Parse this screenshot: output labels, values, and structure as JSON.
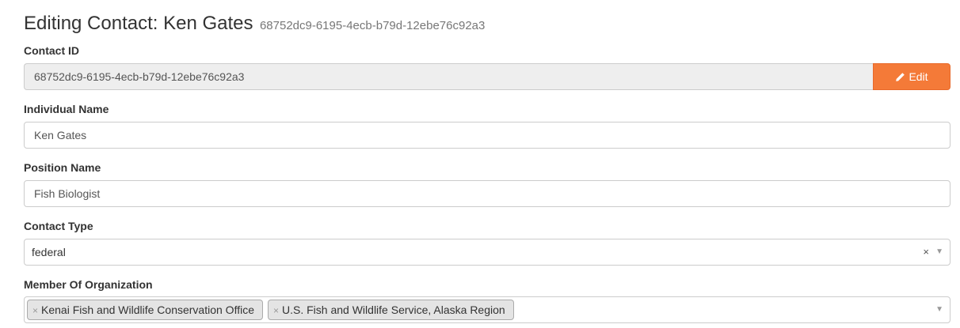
{
  "header": {
    "title": "Editing Contact: Ken Gates",
    "subtitle": "68752dc9-6195-4ecb-b79d-12ebe76c92a3"
  },
  "contact_id": {
    "label": "Contact ID",
    "value": "68752dc9-6195-4ecb-b79d-12ebe76c92a3",
    "edit_label": "Edit",
    "edit_icon": "pencil-icon",
    "edit_color": "#f47a38"
  },
  "individual_name": {
    "label": "Individual Name",
    "value": "Ken Gates"
  },
  "position_name": {
    "label": "Position Name",
    "value": "Fish Biologist"
  },
  "contact_type": {
    "label": "Contact Type",
    "selected": "federal",
    "clear_symbol": "×",
    "arrow_symbol": "▼"
  },
  "member_of_organization": {
    "label": "Member Of Organization",
    "tags": [
      {
        "remove": "×",
        "label": "Kenai Fish and Wildlife Conservation Office"
      },
      {
        "remove": "×",
        "label": "U.S. Fish and Wildlife Service, Alaska Region"
      }
    ],
    "arrow_symbol": "▼"
  }
}
